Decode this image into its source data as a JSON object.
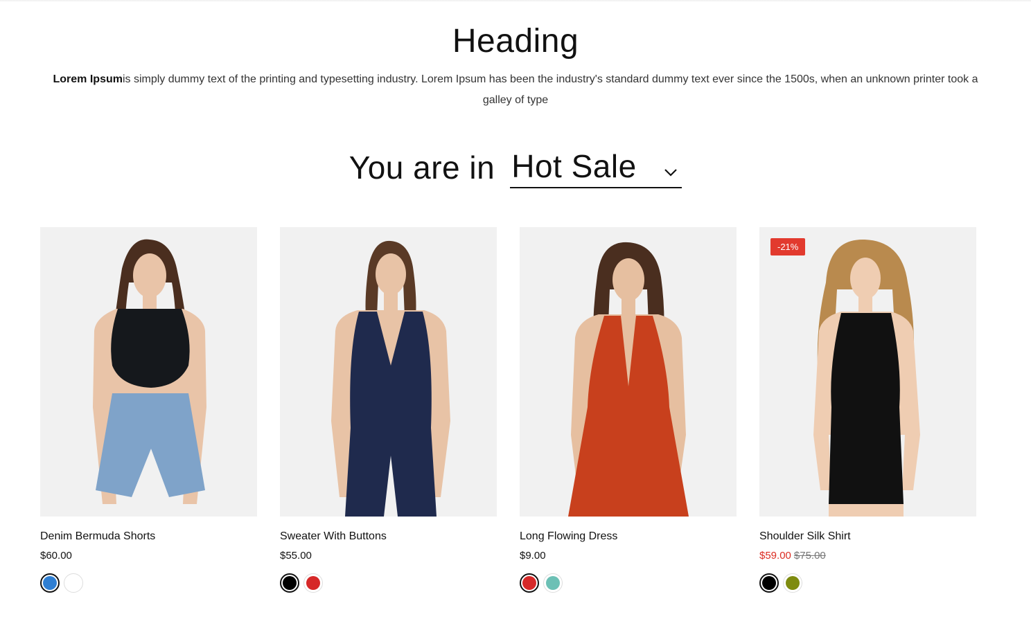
{
  "header": {
    "title": "Heading",
    "desc_lead": "Lorem Ipsum",
    "desc_rest": "is simply dummy text of the printing and typesetting industry. Lorem Ipsum has been the industry's standard dummy text ever since the 1500s, when an unknown printer took a galley of type"
  },
  "selector": {
    "prefix": "You are in",
    "value": "Hot Sale",
    "icon": "chevron-down-icon"
  },
  "products": [
    {
      "name": "Denim Bermuda Shorts",
      "price": "$60.00",
      "badge": "",
      "swatches": [
        {
          "color": "#2f7fd3",
          "active": true
        },
        {
          "color": "#ffffff",
          "active": false
        }
      ],
      "top_color": "#15181c",
      "bottom_color": "#7fa3c9",
      "hair_color": "#4a2e1f"
    },
    {
      "name": "Sweater With Buttons",
      "price": "$55.00",
      "badge": "",
      "swatches": [
        {
          "color": "#000000",
          "active": true
        },
        {
          "color": "#d62828",
          "active": false
        }
      ],
      "top_color": "#1f2a4d",
      "bottom_color": "#1f2a4d",
      "hair_color": "#5a3a26"
    },
    {
      "name": "Long Flowing Dress",
      "price": "$9.00",
      "badge": "",
      "swatches": [
        {
          "color": "#d62828",
          "active": true
        },
        {
          "color": "#6cc0b5",
          "active": false
        }
      ],
      "top_color": "#c8401d",
      "bottom_color": "#c8401d",
      "hair_color": "#4a2e1f"
    },
    {
      "name": "Shoulder Silk Shirt",
      "sale_price": "$59.00",
      "old_price": "$75.00",
      "badge": "-21%",
      "swatches": [
        {
          "color": "#000000",
          "active": true
        },
        {
          "color": "#7e8b0f",
          "active": false
        }
      ],
      "top_color": "#111111",
      "bottom_color": "#111111",
      "hair_color": "#b98a4e"
    }
  ],
  "colors": {
    "badge": "#e23a2e",
    "sale": "#db2b21",
    "image_bg": "#f1f1f1"
  }
}
